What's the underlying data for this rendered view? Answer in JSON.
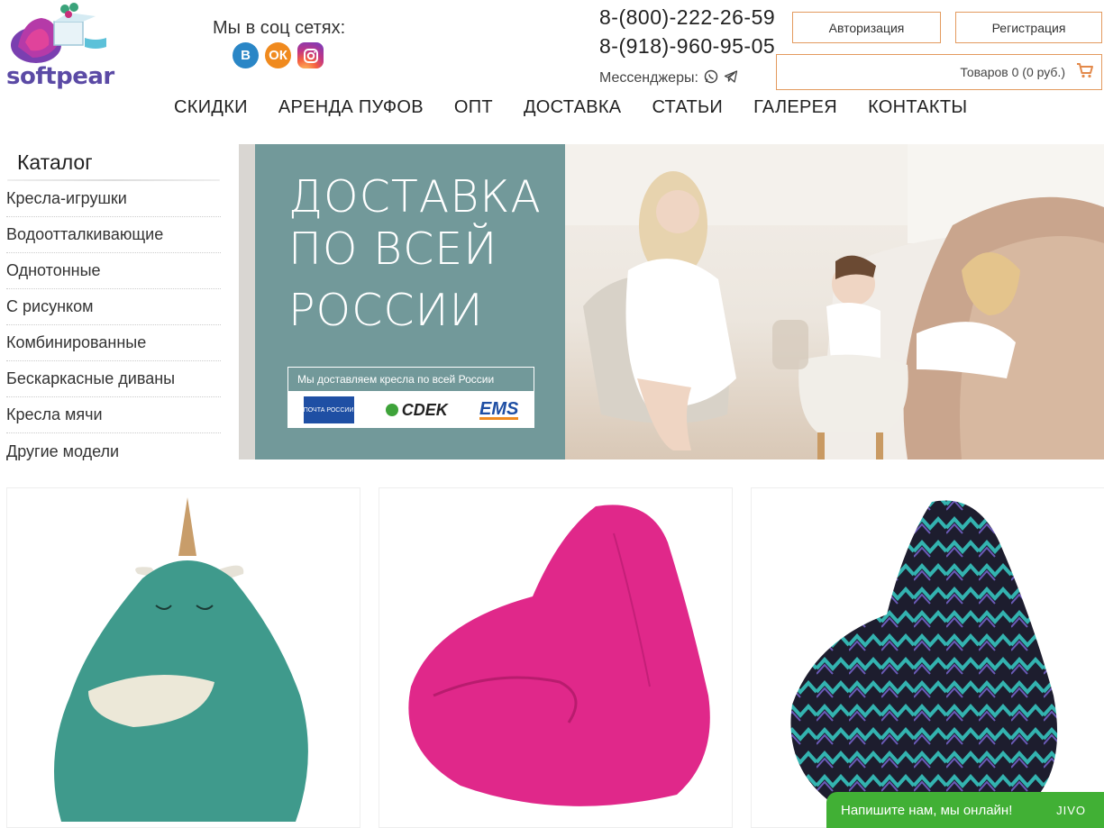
{
  "brand": {
    "name": "softpear"
  },
  "social": {
    "title": "Мы в соц сетях:",
    "items": [
      {
        "name": "vk",
        "glyph": "В",
        "color": "#2a86c6"
      },
      {
        "name": "ok",
        "glyph": "ОК",
        "color": "#f08a1e"
      },
      {
        "name": "instagram",
        "glyph": "◎",
        "color": "#c13584"
      }
    ]
  },
  "contacts": {
    "phone1": "8-(800)-222-26-59",
    "phone2": "8-(918)-960-95-05",
    "messengers_label": "Мессенджеры:",
    "messenger_icons": [
      "whatsapp-icon",
      "telegram-icon"
    ]
  },
  "account": {
    "login_label": "Авторизация",
    "register_label": "Регистрация"
  },
  "cart": {
    "summary": "Товаров 0 (0 руб.)"
  },
  "nav": [
    "СКИДКИ",
    "АРЕНДА ПУФОВ",
    "ОПТ",
    "ДОСТАВКА",
    "СТАТЬИ",
    "ГАЛЕРЕЯ",
    "КОНТАКТЫ"
  ],
  "catalog": {
    "title": "Каталог",
    "items": [
      "Кресла-игрушки",
      "Водоотталкивающие",
      "Однотонные",
      "С рисунком",
      "Комбинированные",
      "Бескаркасные диваны",
      "Кресла мячи",
      "Другие модели"
    ]
  },
  "banner": {
    "line1": "ДОСТАВКА",
    "line2": "ПО ВСЕЙ",
    "line3": "РОССИИ",
    "strip": "Мы доставляем кресла по всей России",
    "logos": {
      "pochta": "ПОЧТА РОССИИ",
      "cdek": "CDEK",
      "ems": "EMS"
    }
  },
  "products": [
    {
      "name": "unicorn-beanbag",
      "color": "#3f9a8c"
    },
    {
      "name": "pink-beanbag",
      "color": "#e0288a"
    },
    {
      "name": "pattern-beanbag",
      "color": "#1d1d2e"
    }
  ],
  "chat": {
    "label": "Напишите нам, мы онлайн!",
    "brand": "JIVO",
    "color": "#41b035"
  }
}
